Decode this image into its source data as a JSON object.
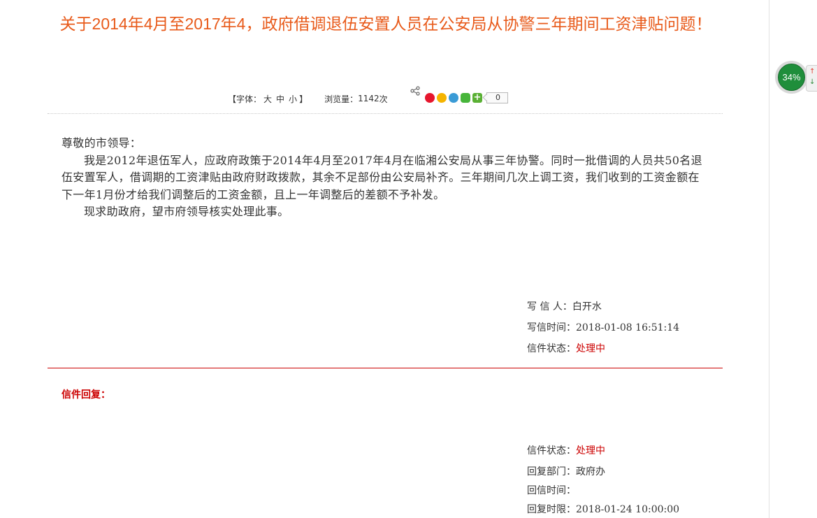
{
  "page_title": "关于2014年4月至2017年4，政府借调退伍安置人员在公安局从协警三年期间工资津贴问题！",
  "meta": {
    "font_label_open": "【字体：",
    "font_large": "大",
    "font_medium": "中",
    "font_small": "小",
    "font_label_close": "】",
    "views_label": "浏览量：",
    "views_count": "1142",
    "views_unit": "次",
    "share_count": "0"
  },
  "share_icons": [
    "share-icon",
    "weibo-icon",
    "qzone-icon",
    "tencent-weibo-icon",
    "wechat-icon",
    "more-plus-icon"
  ],
  "letter": {
    "greeting": "尊敬的市领导：",
    "paragraph1": "我是2012年退伍军人，应政府政策于2014年4月至2017年4月在临湘公安局从事三年协警。同时一批借调的人员共50名退伍安置军人，借调期的工资津贴由政府财政拨款，其余不足部份由公安局补齐。三年期间几次上调工资，我们收到的工资金额在下一年1月份才给我们调整后的工资金额，且上一年调整后的差额不予补发。",
    "paragraph2": "现求助政府，望市府领导核实处理此事。"
  },
  "letter_info": {
    "writer_label": "写 信 人：",
    "writer": "白开水",
    "time_label": "写信时间：",
    "time": "2018-01-08 16:51:14",
    "status_label": "信件状态：",
    "status": "处理中"
  },
  "reply": {
    "heading": "信件回复：",
    "status_label": "信件状态：",
    "status": "处理中",
    "dept_label": "回复部门：",
    "dept": "政府办",
    "reply_time_label": "回信时间：",
    "reply_time": "",
    "deadline_label": "回复时限：",
    "deadline": "2018-01-24 10:00:00"
  },
  "widget": {
    "percent": "34%",
    "up_arrow": "↑",
    "down_arrow": "↓"
  },
  "colors": {
    "title": "#e85a1a",
    "status_red": "#cc0000",
    "gauge_green": "#1f8e3b"
  }
}
